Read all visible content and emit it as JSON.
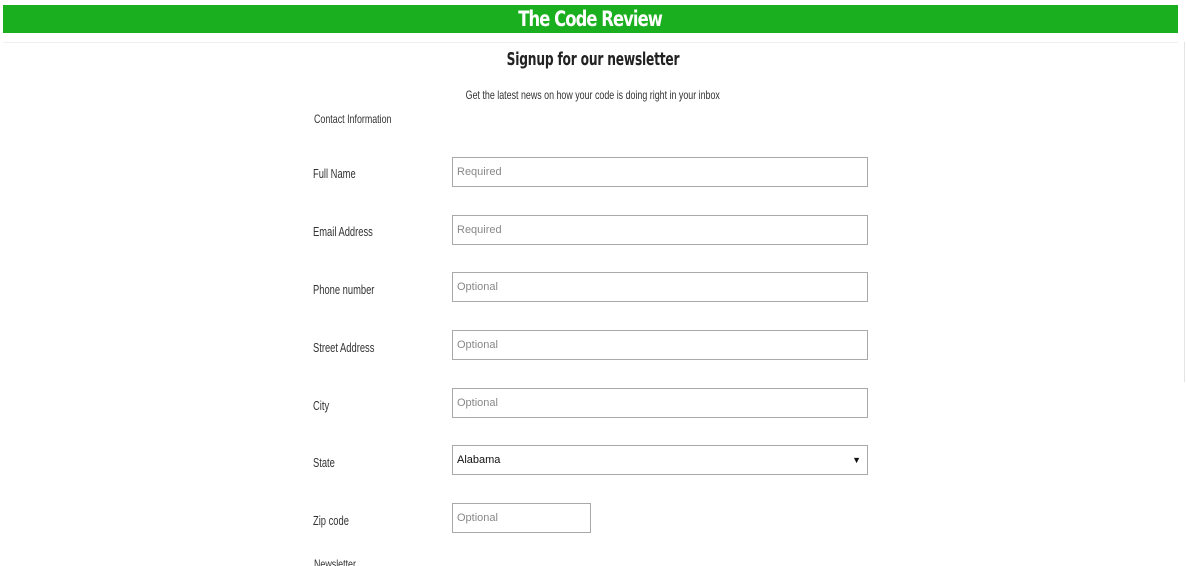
{
  "header": {
    "title": "The Code Review"
  },
  "signup": {
    "heading": "Signup for our newsletter",
    "subtitle": "Get the latest news on how your code is doing right in your inbox"
  },
  "form": {
    "contact_section": "Contact Information",
    "newsletter_section": "Newsletter",
    "fields": {
      "full_name": {
        "label": "Full Name",
        "placeholder": "Required"
      },
      "email": {
        "label": "Email Address",
        "placeholder": "Required"
      },
      "phone": {
        "label": "Phone number",
        "placeholder": "Optional"
      },
      "street": {
        "label": "Street Address",
        "placeholder": "Optional"
      },
      "city": {
        "label": "City",
        "placeholder": "Optional"
      },
      "state": {
        "label": "State",
        "selected": "Alabama",
        "arrow": "▼"
      },
      "zip": {
        "label": "Zip code",
        "placeholder": "Optional"
      }
    }
  },
  "colors": {
    "header_bg": "#1aaf1f",
    "header_text": "#ffffff"
  }
}
